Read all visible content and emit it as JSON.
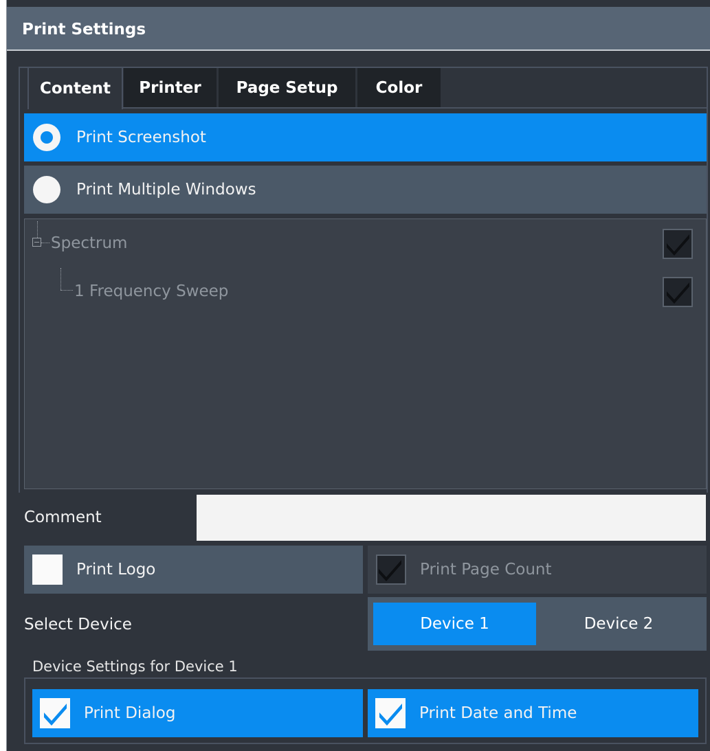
{
  "dialog": {
    "title": "Print Settings"
  },
  "tabs": [
    {
      "label": "Content",
      "active": true
    },
    {
      "label": "Printer",
      "active": false
    },
    {
      "label": "Page Setup",
      "active": false
    },
    {
      "label": "Color",
      "active": false
    }
  ],
  "print_mode": {
    "options": [
      {
        "label": "Print Screenshot",
        "selected": true
      },
      {
        "label": "Print Multiple Windows",
        "selected": false
      }
    ]
  },
  "windows_tree": {
    "root": {
      "label": "Spectrum",
      "checked": true,
      "expander": "⊟"
    },
    "children": [
      {
        "label": "1 Frequency Sweep",
        "checked": true
      }
    ]
  },
  "comment": {
    "label": "Comment",
    "value": ""
  },
  "print_logo": {
    "label": "Print Logo",
    "checked": false
  },
  "print_page_count": {
    "label": "Print Page Count",
    "checked": true,
    "enabled": false
  },
  "select_device": {
    "label": "Select Device",
    "options": [
      "Device 1",
      "Device 2"
    ],
    "selected": "Device 1"
  },
  "device_settings": {
    "group_label": "Device Settings for Device 1",
    "print_dialog": {
      "label": "Print Dialog",
      "checked": true
    },
    "print_date_time": {
      "label": "Print Date and Time",
      "checked": true
    }
  },
  "colors": {
    "accent": "#0a8cf0",
    "title_bar": "#576575",
    "background": "#2f343c",
    "inactive_row": "#4b5968"
  }
}
